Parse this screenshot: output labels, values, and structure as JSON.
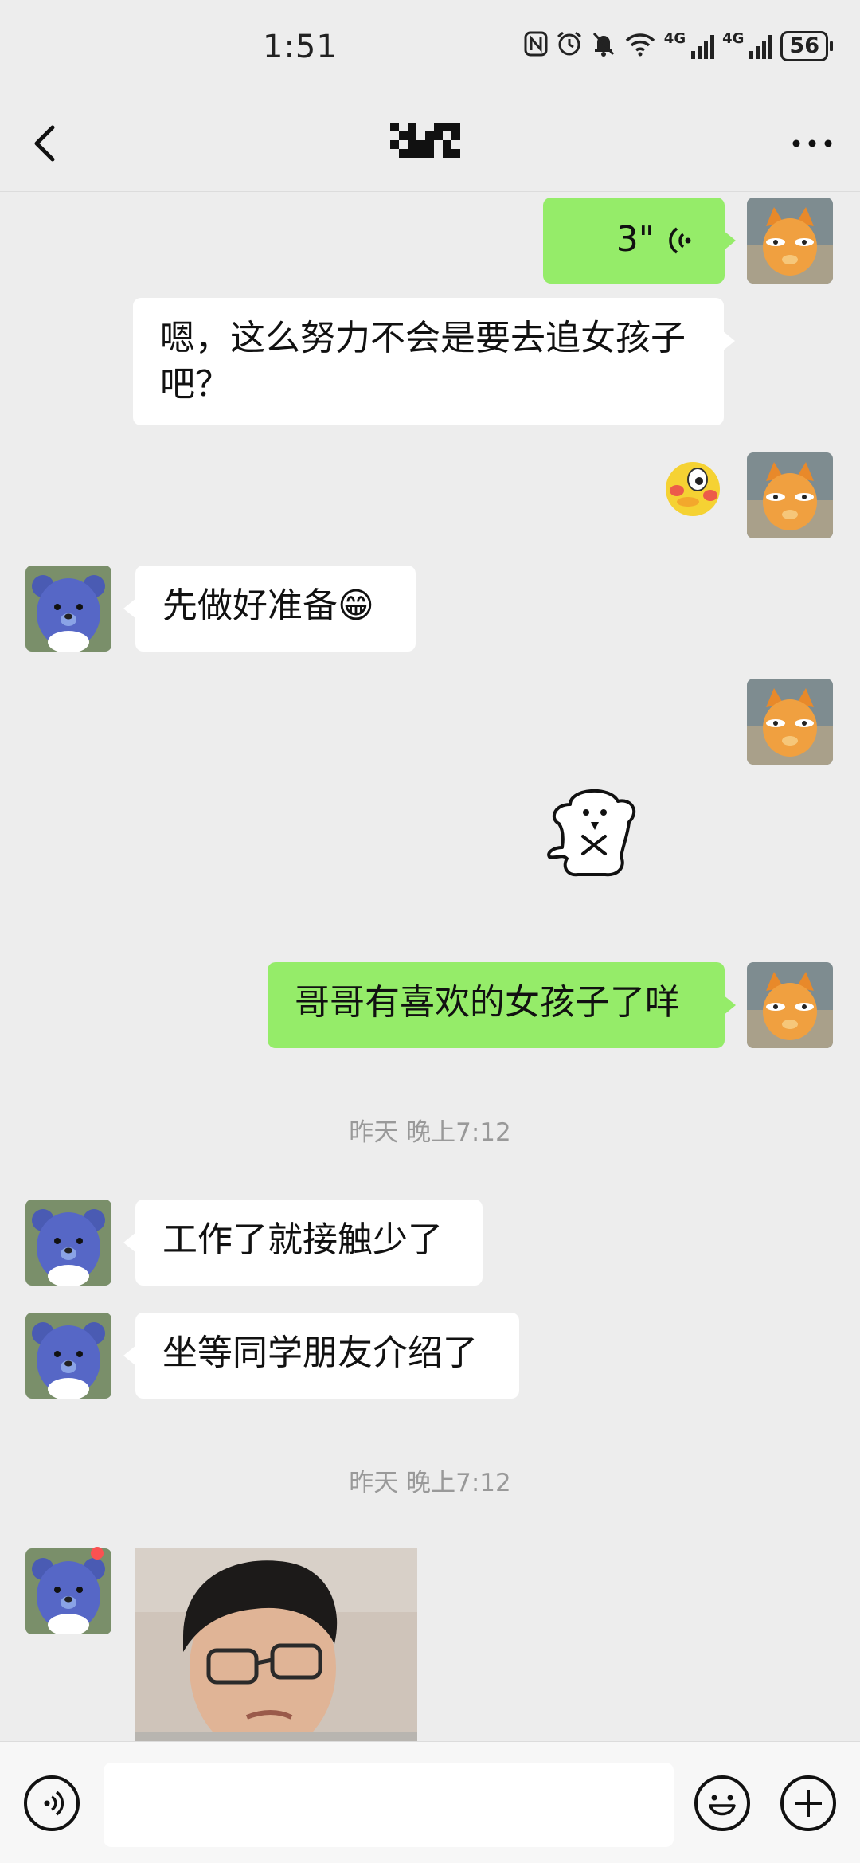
{
  "status_bar": {
    "time": "1:51",
    "network_1": "4G",
    "network_2": "4G",
    "battery": "56"
  },
  "nav": {
    "back_icon": "chevron-left-icon",
    "title_icon": "pixelated-name",
    "more_icon": "ellipsis-icon"
  },
  "messages": {
    "m1_voice_duration": "3\"",
    "m2_text": "嗯，这么努力不会是要去追女孩子吧？",
    "m4_text": "先做好准备😁",
    "m6_text": "哥哥有喜欢的女孩子了咩",
    "t1": "昨天 晚上7:12",
    "m7_text": "工作了就接触少了",
    "m8_text": "坐等同学朋友介绍了",
    "t2": "昨天 晚上7:12"
  },
  "input_bar": {
    "voice_icon": "voice-mode-icon",
    "emoji_icon": "emoji-icon",
    "plus_icon": "plus-icon"
  },
  "colors": {
    "background": "#ededed",
    "sent_bubble": "#95ec69",
    "received_bubble": "#ffffff",
    "timestamp": "#999999"
  }
}
